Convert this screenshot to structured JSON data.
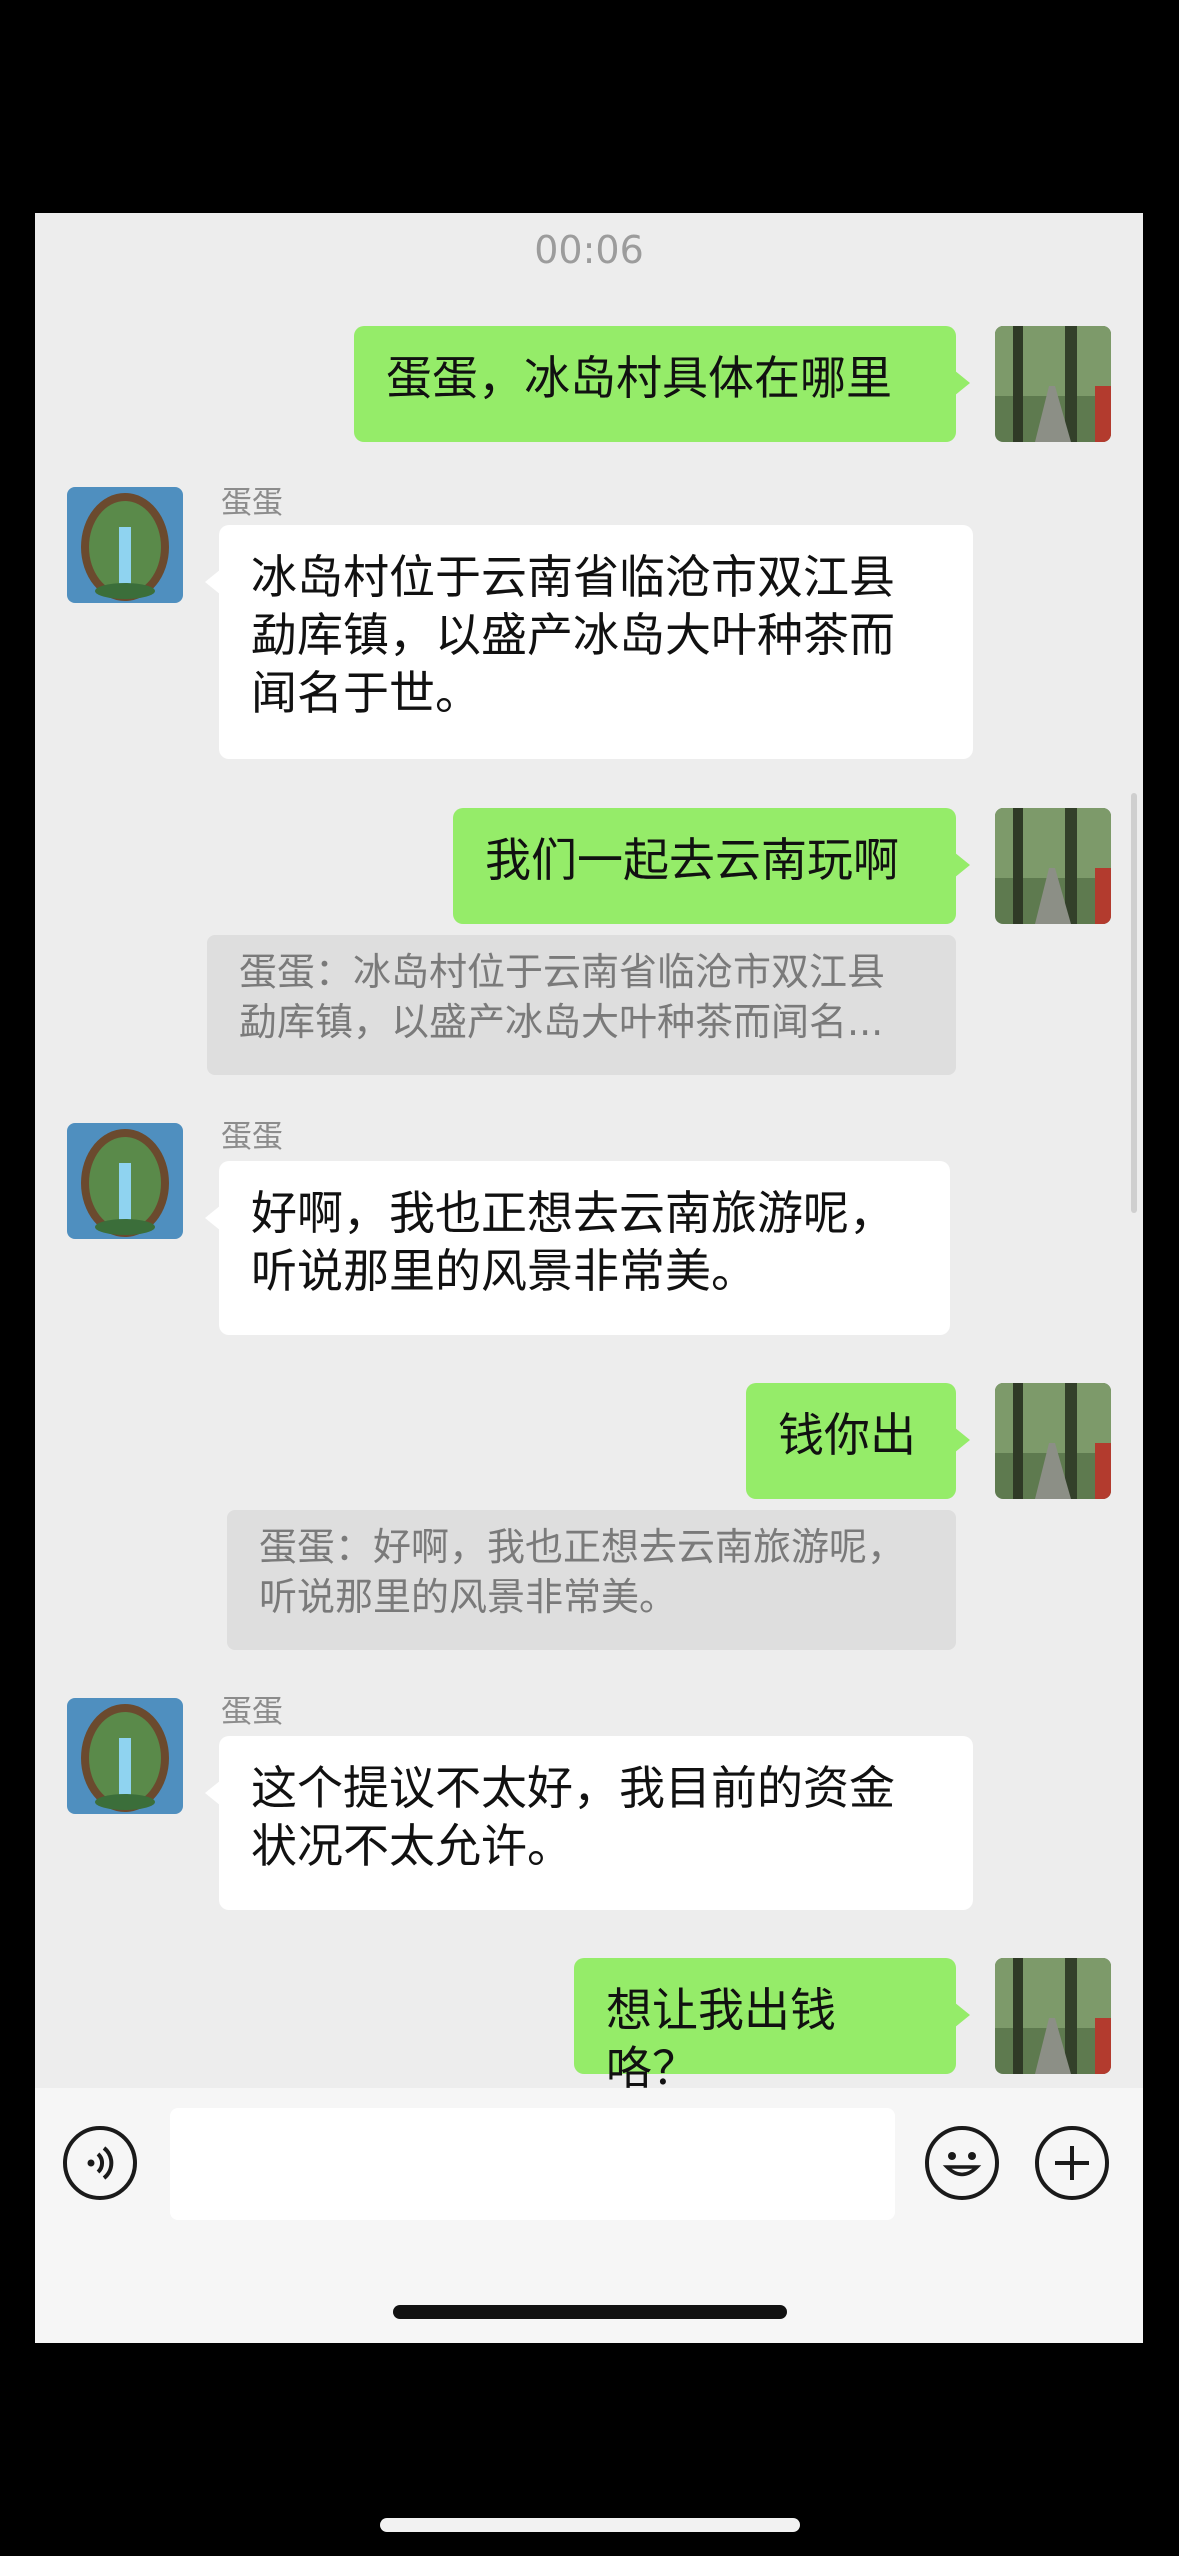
{
  "timestamp": "00:06",
  "contact_name": "蛋蛋",
  "messages": [
    {
      "from": "me",
      "text": "蛋蛋，冰岛村具体在哪里"
    },
    {
      "from": "them",
      "sender": "蛋蛋",
      "text": "冰岛村位于云南省临沧市双江县\n勐库镇，以盛产冰岛大叶种茶而\n闻名于世。"
    },
    {
      "from": "me",
      "text": "我们一起去云南玩啊",
      "quote": "蛋蛋：冰岛村位于云南省临沧市双江县\n勐库镇，以盛产冰岛大叶种茶而闻名..."
    },
    {
      "from": "them",
      "sender": "蛋蛋",
      "text": "好啊，我也正想去云南旅游呢，\n听说那里的风景非常美。"
    },
    {
      "from": "me",
      "text": "钱你出",
      "quote": "蛋蛋：好啊，我也正想去云南旅游呢，\n听说那里的风景非常美。"
    },
    {
      "from": "them",
      "sender": "蛋蛋",
      "text": "这个提议不太好，我目前的资金\n状况不太允许。"
    },
    {
      "from": "me",
      "text": "想让我出钱咯？"
    }
  ],
  "input_bar": {
    "voice_icon": "voice-icon",
    "emoji_icon": "emoji-icon",
    "plus_icon": "plus-icon",
    "input_value": ""
  },
  "colors": {
    "my_bubble": "#95ec69",
    "their_bubble": "#ffffff",
    "chat_background": "#ededed"
  }
}
